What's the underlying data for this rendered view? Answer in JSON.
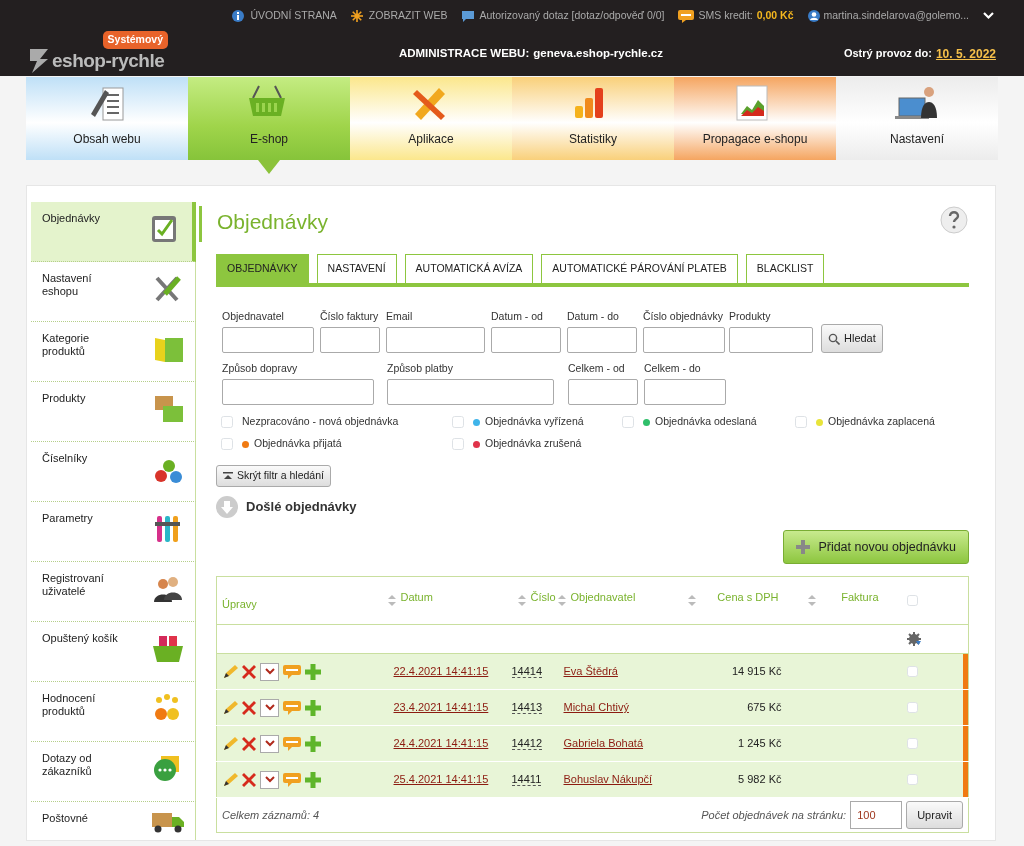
{
  "top_links": [
    {
      "text": "ÚVODNÍ STRANA"
    },
    {
      "text": "ZOBRAZIT WEB"
    },
    {
      "text": "Autorizovaný dotaz [dotaz/odpověď 0/0]"
    }
  ],
  "sms": {
    "label": "SMS kredit:",
    "value": "0,00 Kč"
  },
  "user": {
    "email": "martina.sindelarova@golemo..."
  },
  "logo": {
    "badge": "Systémový",
    "text": "eshop-rychle"
  },
  "admin": {
    "label": "ADMINISTRACE WEBU:",
    "domain": "geneva.eshop-rychle.cz"
  },
  "live_until": {
    "label": "Ostrý provoz do:",
    "date": "10. 5. 2022"
  },
  "main_tabs": [
    {
      "label": "Obsah webu",
      "color": "#bfe0f7",
      "selected": false
    },
    {
      "label": "E-shop",
      "color": "#9fd44a",
      "selected": true
    },
    {
      "label": "Aplikace",
      "color": "#fbe78c",
      "selected": false
    },
    {
      "label": "Statistiky",
      "color": "#f9d07a",
      "selected": false
    },
    {
      "label": "Propagace e-shopu",
      "color": "#f5a560",
      "selected": false
    },
    {
      "label": "Nastavení",
      "color": "#ececec",
      "selected": false
    }
  ],
  "sidebar": {
    "items": [
      {
        "label": "Objednávky",
        "selected": true
      },
      {
        "label": "Nastavení eshopu",
        "selected": false
      },
      {
        "label": "Kategorie produktů",
        "selected": false
      },
      {
        "label": "Produkty",
        "selected": false
      },
      {
        "label": "Číselníky",
        "selected": false
      },
      {
        "label": "Parametry",
        "selected": false
      },
      {
        "label": "Registrovaní uživatelé",
        "selected": false
      },
      {
        "label": "Opuštený košík",
        "selected": false
      },
      {
        "label": "Hodnocení produktů",
        "selected": false
      },
      {
        "label": "Dotazy od zákazníků",
        "selected": false
      },
      {
        "label": "Poštovné",
        "selected": false
      }
    ]
  },
  "page_title": "Objednávky",
  "tabs": [
    {
      "label": "OBJEDNÁVKY",
      "selected": true
    },
    {
      "label": "NASTAVENÍ",
      "selected": false
    },
    {
      "label": "AUTOMATICKÁ AVÍZA",
      "selected": false
    },
    {
      "label": "AUTOMATICKÉ PÁROVÁNÍ PLATEB",
      "selected": false
    },
    {
      "label": "BLACKLIST",
      "selected": false
    }
  ],
  "filters": {
    "row_1": [
      {
        "label": "Objednavatel"
      },
      {
        "label": "Číslo faktury"
      },
      {
        "label": "Email"
      },
      {
        "label": "Datum - od"
      },
      {
        "label": "Datum - do"
      },
      {
        "label": "Číslo objednávky"
      },
      {
        "label": "Produkty"
      }
    ],
    "row_2": [
      {
        "label": "Způsob dopravy"
      },
      {
        "label": "Způsob platby"
      },
      {
        "label": "Celkem - od"
      },
      {
        "label": "Celkem - do"
      }
    ],
    "search_button": "Hledat",
    "statuses": [
      {
        "label": "Nezpracováno - nová objednávka",
        "checked": false
      },
      {
        "label": "Objednávka vyřízená",
        "color": "#3fb4ea",
        "checked": false
      },
      {
        "label": "Objednávka odeslaná",
        "color": "#2fbf6a",
        "checked": false
      },
      {
        "label": "Objednávka zaplacená",
        "color": "#e8e43a",
        "checked": false
      },
      {
        "label": "Objednávka přijatá",
        "color": "#f07a12",
        "checked": false
      },
      {
        "label": "Objednávka zrušená",
        "color": "#e0334a",
        "checked": false
      }
    ]
  },
  "hide_filter_button": "Skrýt filtr a hledání",
  "section_title": "Došlé objednávky",
  "add_button": "Přidat novou objednávku",
  "table": {
    "columns": [
      {
        "label": "Úpravy",
        "sortable": false
      },
      {
        "label": "Datum",
        "sortable": true
      },
      {
        "label": "Číslo",
        "sortable": true
      },
      {
        "label": "Objednavatel",
        "sortable": true
      },
      {
        "label": "Cena s DPH",
        "sortable": true
      },
      {
        "label": "Faktura",
        "sortable": true
      }
    ],
    "select_all": false,
    "rows": [
      {
        "date": "22.4.2021 14:41:15",
        "number": "14414",
        "customer": "Eva Štědrá",
        "price": "14 915 Kč",
        "checked": false,
        "color": "#f07a12"
      },
      {
        "date": "23.4.2021 14:41:15",
        "number": "14413",
        "customer": "Michal Chtivý",
        "price": "675 Kč",
        "checked": false,
        "color": "#f07a12"
      },
      {
        "date": "24.4.2021 14:41:15",
        "number": "14412",
        "customer": "Gabriela Bohatá",
        "price": "1 245 Kč",
        "checked": false,
        "color": "#f07a12"
      },
      {
        "date": "25.4.2021 14:41:15",
        "number": "14411",
        "customer": "Bohuslav Nákupčí",
        "price": "5 982 Kč",
        "checked": false,
        "color": "#f07a12"
      }
    ],
    "total": "Celkem záznamů: 4",
    "per_page_label": "Počet objednávek na stránku:",
    "per_page_value": "100",
    "update_button": "Upravit"
  }
}
